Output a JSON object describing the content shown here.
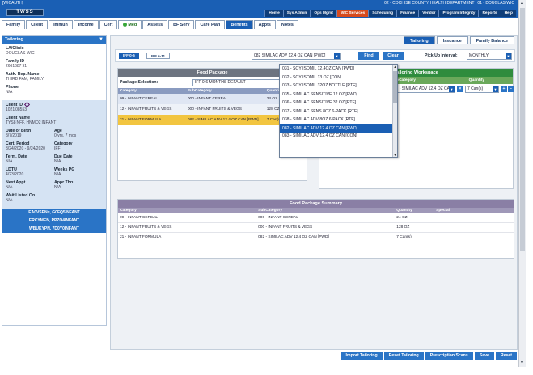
{
  "header": {
    "tag": "[WICAUTH]",
    "logo": "TWSS",
    "location": "02 - COCHISE COUNTY HEALTH DEPARTMENT | 01 - DOUGLAS WIC",
    "menu": [
      "Home",
      "Sys Admin",
      "Ops Mgmt",
      "WIC Services",
      "Scheduling",
      "Finance",
      "Vendor",
      "Program Integrity",
      "Reports",
      "Help"
    ],
    "active_menu": "WIC Services"
  },
  "module_tabs": [
    "Family",
    "Client",
    "Immun",
    "Income",
    "Cert",
    "Med",
    "Assess",
    "BF Serv",
    "Care Plan",
    "Benefits",
    "Appts",
    "Notes"
  ],
  "active_module": "Benefits",
  "sidebar": {
    "title": "Tailoring",
    "la_clinic_label": "LA/Clinic",
    "la_clinic": "DOUGLAS WIC",
    "family_id_label": "Family ID",
    "family_id": "2661687 91",
    "auth_rep_label": "Auth. Rep. Name",
    "auth_rep": "THIRD FAM, FAMILY",
    "phone_label": "Phone",
    "phone": "N/A",
    "client_id_label": "Client ID",
    "client_id": "1021 08553",
    "client_name_label": "Client Name",
    "client_name": "TYS8 NFF, HNMQ2 INFANT",
    "dob_label": "Date of Birth",
    "dob": "8/7/2019",
    "age_label": "Age",
    "age": "0 yrs, 7 mos",
    "cert_period_label": "Cert. Period",
    "cert_period": "3/24/2020 - 9/24/2020",
    "category_label": "Category",
    "category": "IFF",
    "term_date_label": "Term. Date",
    "term_date": "N/A",
    "due_date_label": "Due Date",
    "due_date": "N/A",
    "ldtu_label": "LDTU",
    "ldtu": "4/23/2020",
    "weeks_pg_label": "Weeks PG",
    "weeks_pg": "N/A",
    "next_appt_label": "Next Appt.",
    "next_appt": "N/A",
    "appr_thru_label": "Appr Thru",
    "appr_thru": "N/A",
    "wait_label": "Wait Listed On",
    "wait": "N/A",
    "family_buttons": [
      "EA0VSPN=, G0FQ5INFANT",
      "ERCYMEN, PPZO4INFANT",
      "WBUKYPN, 7D0Y0INFANT"
    ]
  },
  "subtabs": [
    "Tailoring",
    "Issuance",
    "Family Balance"
  ],
  "active_subtab": "Tailoring",
  "fp_tabs": [
    "IFF 0-6",
    "IFF 6-11"
  ],
  "product_select": "082 SIMILAC ADV 12.4 OZ CAN [PWD]",
  "find_label": "Find",
  "clear_label": "Clear",
  "pickup_label": "Pick Up Interval:",
  "pickup_value": "MONTHLY",
  "food_package": {
    "title": "Food Package",
    "selection_label": "Package Selection:",
    "selection_value": "IFF 0-6 MONTHS DEFAULT",
    "columns": [
      "Category",
      "SubCategory",
      "Quantity",
      "Tailor"
    ],
    "rows": [
      {
        "category": "09 - INFANT CEREAL",
        "subcategory": "000 - INFANT CEREAL",
        "quantity": "24 OZ"
      },
      {
        "category": "12 - INFANT FRUITS & VEGS",
        "subcategory": "000 - INFANT FRUITS & VEGS",
        "quantity": "128 OZ"
      },
      {
        "category": "21 - INFANT FORMULA",
        "subcategory": "082 - SIMILAC ADV 12.4 OZ CAN [PWD]",
        "quantity": "7 Can(s)"
      }
    ]
  },
  "workspace": {
    "title": "Tailoring Workspace",
    "columns": [
      "Category",
      "SubCategory",
      "Quantity"
    ],
    "row_category": "21 - INFANT FORMULA",
    "row_subcategory": "082 - SIMILAC ADV 12.4 OZ CAN",
    "row_quantity": "7 Can(s)",
    "dropdown_items": [
      "031 - SOY ISOMIL 12.4OZ CAN [PWD]",
      "032 - SOY ISOMIL 13 OZ [CON]",
      "033 - SOY ISOMIL 32OZ BOTTLE [RTF]",
      "035 - SIMILAC SENSITIVE 12 OZ [PWD]",
      "036 - SIMILAC SENSITIVE 32 OZ [RTF]",
      "037 - SIMILAC SENS 8OZ 6-PACK [RTF]",
      "038 - SIMILAC ADV 8OZ 6-PACK [RTF]",
      "082 - SIMILAC ADV 12.4 OZ CAN [PWD]",
      "083 - SIMILAC ADV 12.4 OZ CAN [CON]"
    ],
    "selected_index": 7
  },
  "summary": {
    "title": "Food Package Summary",
    "columns": [
      "Category",
      "SubCategory",
      "Quantity",
      "Special"
    ],
    "rows": [
      {
        "category": "09 - INFANT CEREAL",
        "subcategory": "000 - INFANT CEREAL",
        "quantity": "24 OZ",
        "special": ""
      },
      {
        "category": "12 - INFANT FRUITS & VEGS",
        "subcategory": "000 - INFANT FRUITS & VEGS",
        "quantity": "128 OZ",
        "special": ""
      },
      {
        "category": "21 - INFANT FORMULA",
        "subcategory": "082 - SIMILAC ADV 12.4 OZ CAN [PWD]",
        "quantity": "7 Can(s)",
        "special": ""
      }
    ]
  },
  "bottom_buttons": [
    "Import Tailoring",
    "Reset Tailoring",
    "Prescription Scans",
    "Save",
    "Reset"
  ],
  "colors": {
    "primary": "#1a5fb4",
    "active_menu": "#d64a1e",
    "workspace": "#2f8c3d",
    "highlight_row": "#f2c540"
  }
}
